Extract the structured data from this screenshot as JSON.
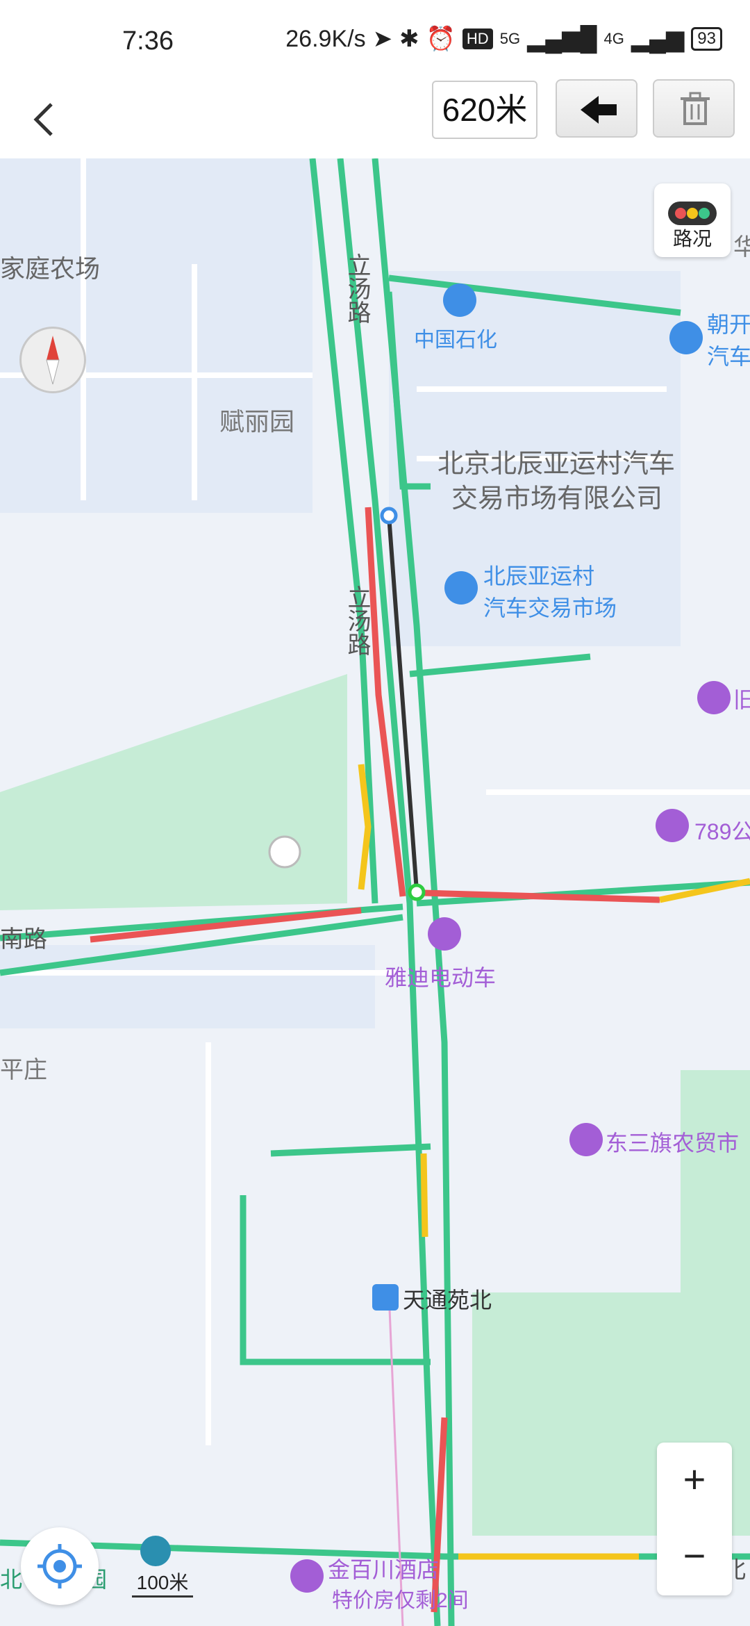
{
  "status": {
    "time": "7:36",
    "speed": "26.9K/s",
    "battery": "93",
    "net1": "5G",
    "net2": "4G",
    "hd": "HD"
  },
  "toolbar": {
    "distance": "620米"
  },
  "map_labels": {
    "jiating": "家庭农场",
    "litang1": "立汤路",
    "litang2": "立汤路",
    "zhongguo": "中国石化",
    "fuliyuan": "赋丽园",
    "beichen1": "北京北辰亚运村汽车",
    "beichen2": "交易市场有限公司",
    "yayun1": "北辰亚运村",
    "yayun2": "汽车交易市场",
    "yadi": "雅迪电动车",
    "nanlu": "南路",
    "pingzhuang": "平庄",
    "dongsan": "东三旗农贸市",
    "tiantong": "天通苑北",
    "jinbai": "金百川酒店",
    "tejia": "特价房仅剩2间",
    "chaokai1": "朝开",
    "chaokai2": "汽车",
    "n789": "789公",
    "jiu": "旧",
    "hua": "华",
    "bei": "北",
    "yuan": "园",
    "beiL": "北"
  },
  "traffic": {
    "label": "路况"
  },
  "zoom": {
    "in": "+",
    "out": "−"
  },
  "scale": {
    "label": "100米"
  },
  "colors": {
    "road_green": "#3cc68a",
    "road_red": "#ea5455",
    "road_yellow": "#f4c51c",
    "route": "#333333",
    "poi_blue": "#3f8fe6",
    "poi_purple": "#a35ed6",
    "park": "#c6ecd6"
  }
}
